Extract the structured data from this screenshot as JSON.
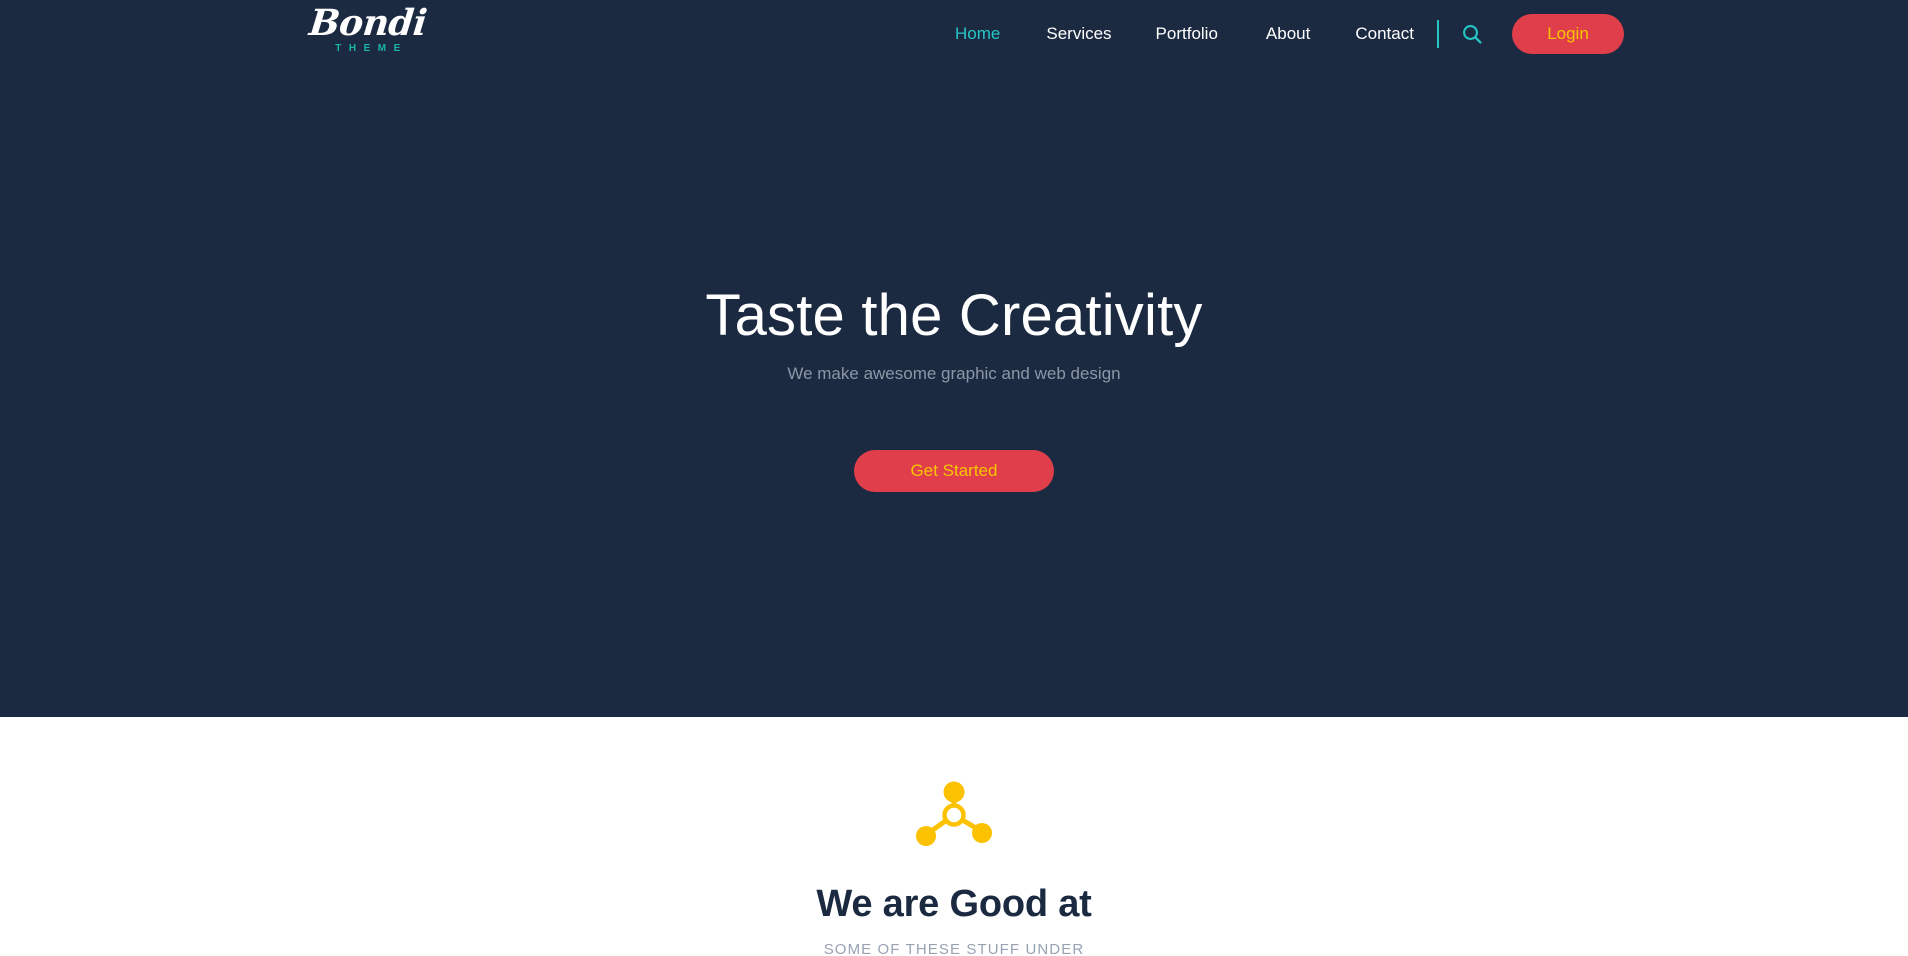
{
  "site": {
    "background_dark": "#1b2a41",
    "accent_teal": "#26c6c6",
    "accent_red": "#e03e4b",
    "accent_gold": "#f7c600",
    "accent_yellow": "#fcc200"
  },
  "header": {
    "logo": {
      "word": "Bondi",
      "subtitle": "THEME"
    },
    "nav": [
      {
        "label": "Home",
        "active": true
      },
      {
        "label": "Services",
        "active": false
      },
      {
        "label": "Portfolio",
        "active": false
      },
      {
        "label": "About",
        "active": false
      },
      {
        "label": "Contact",
        "active": false
      }
    ],
    "search_icon": "search-icon",
    "login_label": "Login"
  },
  "hero": {
    "title": "Taste the Creativity",
    "subtitle": "We make awesome graphic and web design",
    "cta_label": "Get Started"
  },
  "features": {
    "icon": "network-nodes-icon",
    "title": "We are Good at",
    "subtitle": "SOME OF THESE STUFF UNDER"
  }
}
